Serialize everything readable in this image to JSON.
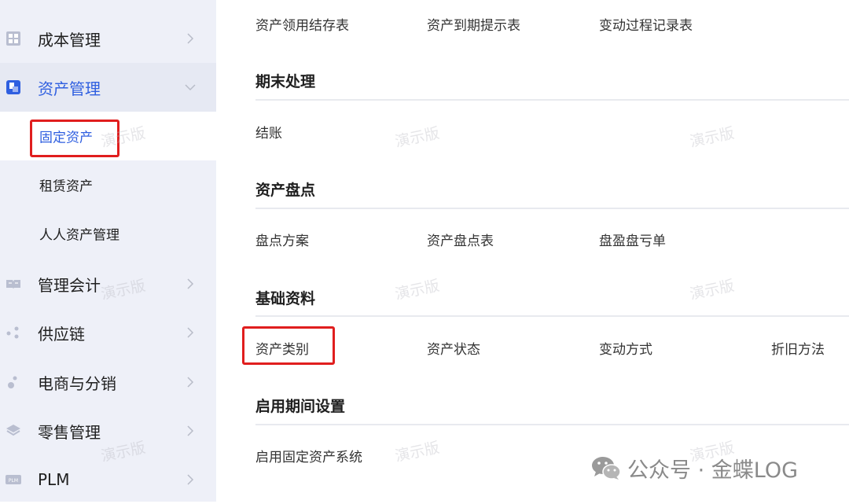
{
  "sidebar": {
    "items": [
      {
        "label": "成本管理",
        "icon": "grid-icon"
      },
      {
        "label": "资产管理",
        "icon": "asset-icon"
      },
      {
        "label": "管理会计",
        "icon": "book-icon"
      },
      {
        "label": "供应链",
        "icon": "dots-icon"
      },
      {
        "label": "电商与分销",
        "icon": "bubbles-icon"
      },
      {
        "label": "零售管理",
        "icon": "layers-icon"
      },
      {
        "label": "PLM",
        "icon": "plm-icon"
      }
    ],
    "sub_items": [
      {
        "label": "固定资产"
      },
      {
        "label": "租赁资产"
      },
      {
        "label": "人人资产管理"
      }
    ],
    "plm_icon_text": "PLM"
  },
  "main": {
    "top_links": [
      "资产领用结存表",
      "资产到期提示表",
      "变动过程记录表"
    ],
    "sections": [
      {
        "title": "期末处理",
        "links": [
          "结账"
        ]
      },
      {
        "title": "资产盘点",
        "links": [
          "盘点方案",
          "资产盘点表",
          "盘盈盘亏单"
        ]
      },
      {
        "title": "基础资料",
        "links": [
          "资产类别",
          "资产状态",
          "变动方式",
          "折旧方法"
        ]
      },
      {
        "title": "启用期间设置",
        "links": [
          "启用固定资产系统"
        ]
      }
    ]
  },
  "watermark": "演示版",
  "brand": {
    "text": "公众号 · 金蝶LOG"
  },
  "colors": {
    "accent": "#2f5fe0",
    "highlight": "#e01e1e",
    "sidebar_bg": "#eef0f8"
  }
}
